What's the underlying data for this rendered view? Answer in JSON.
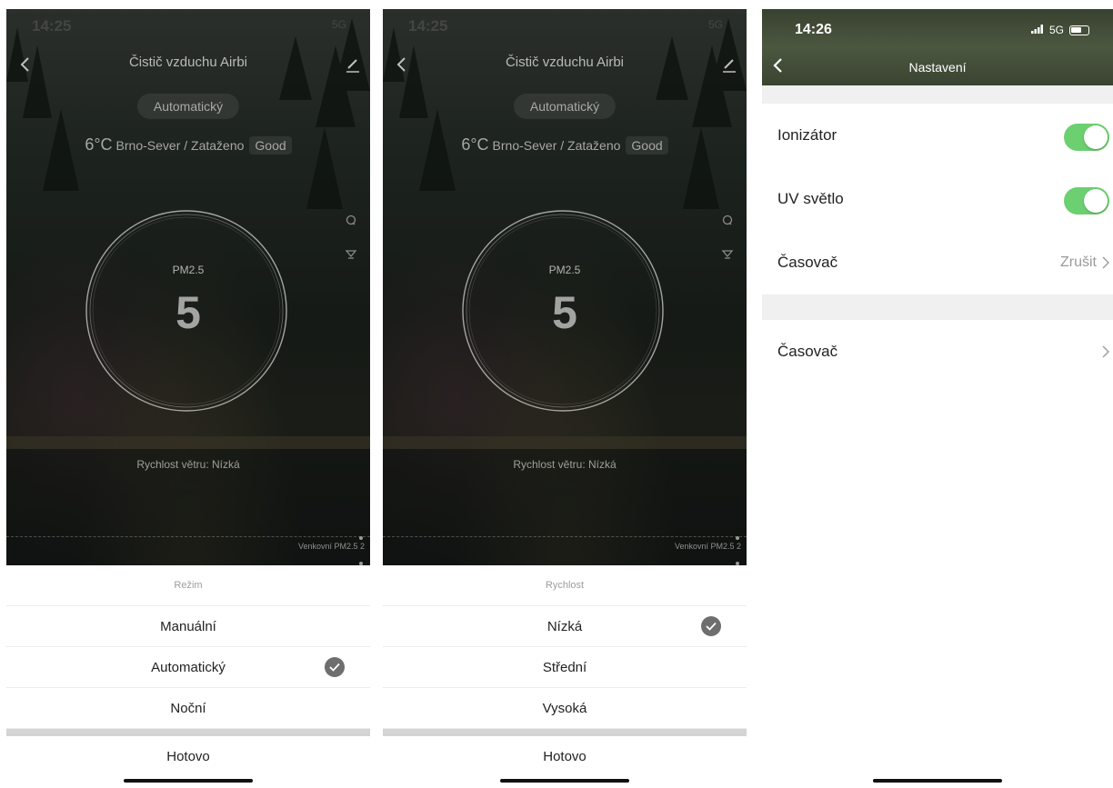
{
  "screens": [
    {
      "status_time": "14:25",
      "status_network": "5G",
      "title": "Čistič vzduchu Airbi",
      "mode_pill": "Automatický",
      "weather": {
        "temp": "6°C",
        "location": "Brno-Sever / Zataženo",
        "air_quality": "Good"
      },
      "pm_label": "PM2.5",
      "pm_value": "5",
      "wind": "Rychlost větru: Nízká",
      "outdoor": "Venkovní PM2.5 2",
      "sheet": {
        "title": "Režim",
        "options": [
          "Manuální",
          "Automatický",
          "Noční"
        ],
        "selected_index": 1,
        "done": "Hotovo"
      }
    },
    {
      "status_time": "14:25",
      "status_network": "5G",
      "title": "Čistič vzduchu Airbi",
      "mode_pill": "Automatický",
      "weather": {
        "temp": "6°C",
        "location": "Brno-Sever / Zataženo",
        "air_quality": "Good"
      },
      "pm_label": "PM2.5",
      "pm_value": "5",
      "wind": "Rychlost větru: Nízká",
      "outdoor": "Venkovní PM2.5 2",
      "sheet": {
        "title": "Rychlost",
        "options": [
          "Nízká",
          "Střední",
          "Vysoká"
        ],
        "selected_index": 0,
        "done": "Hotovo"
      }
    }
  ],
  "settings": {
    "status_time": "14:26",
    "status_network": "5G",
    "title": "Nastavení",
    "rows": {
      "ionizer": {
        "label": "Ionizátor",
        "on": true
      },
      "uv": {
        "label": "UV světlo",
        "on": true
      },
      "timer1": {
        "label": "Časovač",
        "value": "Zrušit"
      },
      "timer2": {
        "label": "Časovač",
        "value": ""
      }
    },
    "colors": {
      "toggle_on": "#6ccf70"
    }
  }
}
